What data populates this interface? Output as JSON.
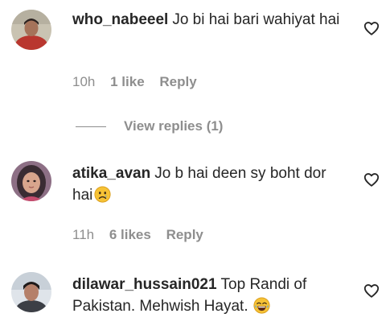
{
  "comments": [
    {
      "username": "who_nabeeel",
      "text": "Jo bi hai bari wahiyat hai",
      "time": "10h",
      "likes": "1 like",
      "reply_label": "Reply",
      "avatar_icon": "profile-photo"
    },
    {
      "username": "atika_avan",
      "text": "Jo b hai deen sy boht dor hai",
      "emoji": "sad-face-emoji",
      "time": "11h",
      "likes": "6 likes",
      "reply_label": "Reply",
      "avatar_icon": "profile-photo"
    },
    {
      "username": "dilawar_hussain021",
      "text": "Top Randi of Pakistan. Mehwish Hayat.",
      "emoji": "laughing-face-emoji",
      "avatar_icon": "profile-photo"
    }
  ],
  "view_replies_label": "View replies (1)",
  "icons": {
    "like": "heart-outline-icon"
  },
  "colors": {
    "text": "#262626",
    "muted": "#8e8e8e",
    "background": "#ffffff",
    "emoji": "#f6c235"
  }
}
